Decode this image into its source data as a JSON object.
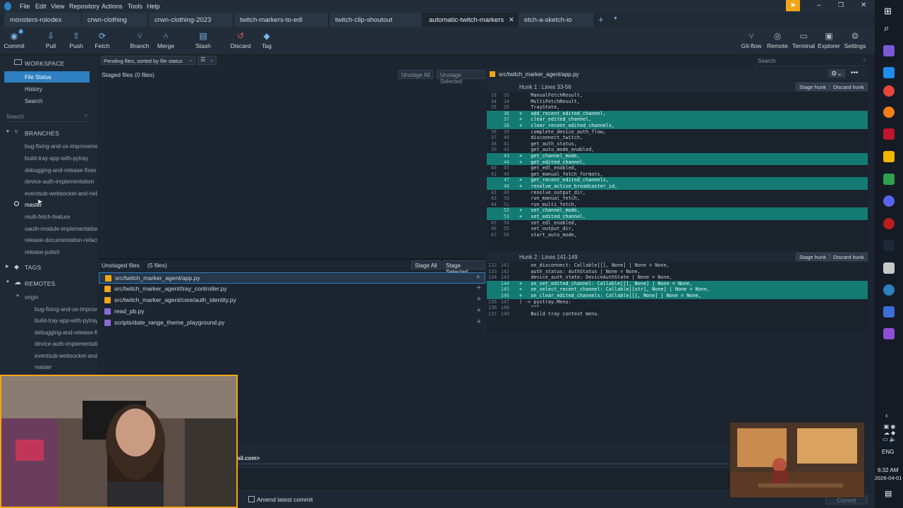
{
  "menubar": {
    "items": [
      "File",
      "Edit",
      "View",
      "Repository",
      "Actions",
      "Tools",
      "Help"
    ]
  },
  "tabs": [
    {
      "label": "monsters-rolodex"
    },
    {
      "label": "crwn-clothing"
    },
    {
      "label": "crwn-clothing-2023"
    },
    {
      "label": "twitch-markers-to-edl"
    },
    {
      "label": "twitch-clip-shoutout"
    },
    {
      "label": "automatic-twitch-markers",
      "active": true
    },
    {
      "label": "etch-a-sketch-io"
    }
  ],
  "toolbar": {
    "left": [
      {
        "label": "Commit",
        "icon": "commit-icon",
        "badge": "3"
      },
      {
        "label": "Pull",
        "icon": "pull-icon"
      },
      {
        "label": "Push",
        "icon": "push-icon"
      },
      {
        "label": "Fetch",
        "icon": "fetch-icon"
      },
      {
        "label": "Branch",
        "icon": "branch-icon"
      },
      {
        "label": "Merge",
        "icon": "merge-icon"
      },
      {
        "label": "Stash",
        "icon": "stash-icon"
      },
      {
        "label": "Discard",
        "icon": "discard-icon"
      },
      {
        "label": "Tag",
        "icon": "tag-icon"
      }
    ],
    "right": [
      {
        "label": "Git-flow",
        "icon": "gitflow-icon"
      },
      {
        "label": "Remote",
        "icon": "remote-icon"
      },
      {
        "label": "Terminal",
        "icon": "terminal-icon"
      },
      {
        "label": "Explorer",
        "icon": "explorer-icon"
      },
      {
        "label": "Settings",
        "icon": "settings-icon"
      }
    ],
    "search_placeholder": "Search"
  },
  "sidebar": {
    "workspace": "WORKSPACE",
    "workspace_items": [
      "File Status",
      "History",
      "Search"
    ],
    "search_placeholder": "Search",
    "branches_title": "BRANCHES",
    "branches": [
      "bug-fixing-and-ux-improvements",
      "build-tray-app-with-pytray",
      "debugging-and-release-fixes",
      "device-auth-implementation",
      "eventsub-websocket-and-helix",
      "master",
      "multi-fetch-feature",
      "oauth-module-implementation",
      "release-documentation-refactor",
      "release-polish"
    ],
    "current_branch": "master",
    "tags_title": "TAGS",
    "remotes_title": "REMOTES",
    "remote_name": "origin",
    "remote_branches": [
      "bug-fixing-and-ux-improvements",
      "build-tray-app-with-pytray",
      "debugging-and-release-fixes",
      "device-auth-implementation",
      "eventsub-websocket-and-helix",
      "master"
    ]
  },
  "staged": {
    "sort_select": "Pending files, sorted by file status",
    "title": "Staged files",
    "count": "(0 files)",
    "unstage_all": "Unstage All",
    "unstage_selected": "Unstage Selected"
  },
  "unstaged": {
    "title": "Unstaged files",
    "count": "(5 files)",
    "stage_all": "Stage All",
    "stage_selected": "Stage Selected",
    "files": [
      {
        "name": "src/twitch_marker_agent/app.py",
        "status": "modified"
      },
      {
        "name": "src/twitch_marker_agent/tray_controller.py",
        "status": "modified"
      },
      {
        "name": "src/twitch_marker_agent/core/auth_identity.py",
        "status": "modified"
      },
      {
        "name": "read_pb.py",
        "status": "untracked"
      },
      {
        "name": "scripts/date_range_theme_playground.py",
        "status": "untracked"
      }
    ]
  },
  "diff": {
    "file": "src/twitch_marker_agent/app.py",
    "stage_hunk": "Stage hunk",
    "discard_hunk": "Discard hunk",
    "hunks": [
      {
        "title": "Hunk 1 : Lines 33-56",
        "lines": [
          {
            "o": "33",
            "n": "33",
            "t": "ctx",
            "c": "    ManualFetchResult,"
          },
          {
            "o": "34",
            "n": "34",
            "t": "ctx",
            "c": "    MultiFetchResult,"
          },
          {
            "o": "35",
            "n": "35",
            "t": "ctx",
            "c": "    TrayState,"
          },
          {
            "o": "",
            "n": "36",
            "t": "add",
            "c": "+   add_recent_edited_channel,"
          },
          {
            "o": "",
            "n": "37",
            "t": "add",
            "c": "+   clear_edited_channel,"
          },
          {
            "o": "",
            "n": "38",
            "t": "add",
            "c": "+   clear_recent_edited_channels,"
          },
          {
            "o": "36",
            "n": "39",
            "t": "ctx",
            "c": "    complete_device_auth_flow,"
          },
          {
            "o": "37",
            "n": "40",
            "t": "ctx",
            "c": "    disconnect_twitch,"
          },
          {
            "o": "38",
            "n": "41",
            "t": "ctx",
            "c": "    get_auth_status,"
          },
          {
            "o": "39",
            "n": "42",
            "t": "ctx",
            "c": "    get_auto_mode_enabled,"
          },
          {
            "o": "",
            "n": "43",
            "t": "add",
            "c": "+   get_channel_mode,"
          },
          {
            "o": "",
            "n": "44",
            "t": "add",
            "c": "+   get_edited_channel,"
          },
          {
            "o": "40",
            "n": "45",
            "t": "ctx",
            "c": "    get_edl_enabled,"
          },
          {
            "o": "41",
            "n": "46",
            "t": "ctx",
            "c": "    get_manual_fetch_formats,"
          },
          {
            "o": "",
            "n": "47",
            "t": "add",
            "c": "+   get_recent_edited_channels,"
          },
          {
            "o": "",
            "n": "48",
            "t": "add",
            "c": "+   resolve_active_broadcaster_id,"
          },
          {
            "o": "42",
            "n": "49",
            "t": "ctx",
            "c": "    resolve_output_dir,"
          },
          {
            "o": "43",
            "n": "50",
            "t": "ctx",
            "c": "    run_manual_fetch,"
          },
          {
            "o": "44",
            "n": "51",
            "t": "ctx",
            "c": "    run_multi_fetch,"
          },
          {
            "o": "",
            "n": "52",
            "t": "add",
            "c": "+   set_channel_mode,"
          },
          {
            "o": "",
            "n": "53",
            "t": "add",
            "c": "+   set_edited_channel,"
          },
          {
            "o": "45",
            "n": "54",
            "t": "ctx",
            "c": "    set_edl_enabled,"
          },
          {
            "o": "46",
            "n": "55",
            "t": "ctx",
            "c": "    set_output_dir,"
          },
          {
            "o": "47",
            "n": "56",
            "t": "ctx",
            "c": "    start_auto_mode,"
          }
        ]
      },
      {
        "title": "Hunk 2 : Lines 141-149",
        "lines": [
          {
            "o": "132",
            "n": "141",
            "t": "ctx",
            "c": "    on_disconnect: Callable[[], None] | None = None,"
          },
          {
            "o": "133",
            "n": "142",
            "t": "ctx",
            "c": "    auth_status: AuthStatus | None = None,"
          },
          {
            "o": "134",
            "n": "143",
            "t": "ctx",
            "c": "    device_auth_state: DeviceAuthState | None = None,"
          },
          {
            "o": "",
            "n": "144",
            "t": "add",
            "c": "+   on_set_edited_channel: Callable[[], None] | None = None,"
          },
          {
            "o": "",
            "n": "145",
            "t": "add",
            "c": "+   on_select_recent_channel: Callable[[str], None] | None = None,"
          },
          {
            "o": "",
            "n": "146",
            "t": "add",
            "c": "+   on_clear_edited_channels: Callable[[], None] | None = None,"
          },
          {
            "o": "135",
            "n": "147",
            "t": "ctx",
            "c": ") -> pystray.Menu:"
          },
          {
            "o": "136",
            "n": "148",
            "t": "ctx",
            "c": "    \"\"\""
          },
          {
            "o": "137",
            "n": "149",
            "t": "ctx",
            "c": "    Build tray context menu."
          }
        ]
      }
    ]
  },
  "commit": {
    "author_fragment": "ail.com>",
    "amend_label": "Amend latest commit",
    "commit_button": "Commit"
  },
  "system": {
    "lang": "ENG",
    "time": "6:32 AM",
    "date": "2026-04-01"
  },
  "colors": {
    "accent": "#2e7fc1",
    "added_line": "#137a74",
    "modified_file": "#f2a515",
    "untracked_file": "#8b6ad8",
    "webcam_border": "#f2a515"
  }
}
